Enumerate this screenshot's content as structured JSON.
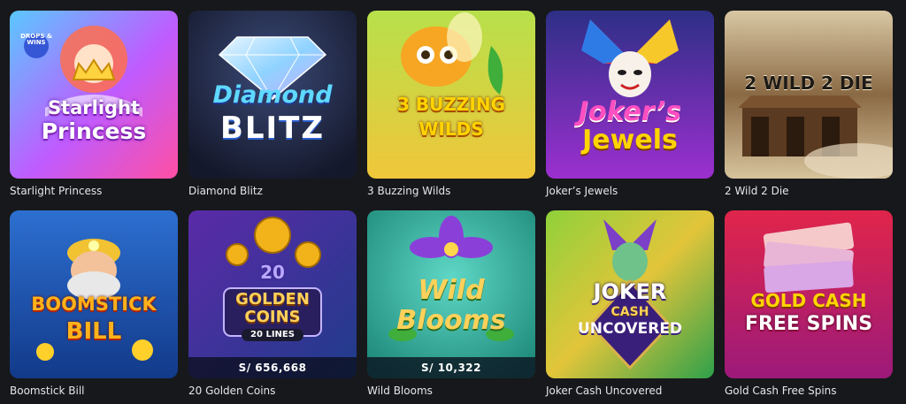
{
  "games": [
    {
      "title": "Starlight Princess",
      "logo_lines": [
        "Starlight",
        "Princess"
      ],
      "badge": "DROPS & WINS",
      "jackpot": null
    },
    {
      "title": "Diamond Blitz",
      "logo_lines": [
        "Diamond",
        "BLITZ"
      ],
      "jackpot": null
    },
    {
      "title": "3 Buzzing Wilds",
      "logo_lines": [
        "3 BUZZING",
        "WILDS"
      ],
      "jackpot": null
    },
    {
      "title": "Joker’s Jewels",
      "logo_lines": [
        "Joker’s",
        "Jewels"
      ],
      "jackpot": null
    },
    {
      "title": "2 Wild 2 Die",
      "logo_lines": [
        "2 WILD 2 DIE"
      ],
      "jackpot": null
    },
    {
      "title": "Boomstick Bill",
      "logo_lines": [
        "BOOMSTICK",
        "BILL"
      ],
      "jackpot": null
    },
    {
      "title": "20 Golden Coins",
      "logo_lines": [
        "20",
        "GOLDEN",
        "COINS",
        "20 LINES"
      ],
      "jackpot": "S/ 656,668"
    },
    {
      "title": "Wild Blooms",
      "logo_lines": [
        "Wild",
        "Blooms"
      ],
      "jackpot": "S/ 10,322"
    },
    {
      "title": "Joker Cash Uncovered",
      "logo_lines": [
        "JOKER",
        "CASH",
        "UNCOVERED"
      ],
      "jackpot": null
    },
    {
      "title": "Gold Cash Free Spins",
      "logo_lines": [
        "GOLD CASH",
        "FREE SPINS"
      ],
      "jackpot": null
    }
  ],
  "colors": {
    "page_background": "#17181b",
    "caption_text": "#e6e6ea"
  }
}
